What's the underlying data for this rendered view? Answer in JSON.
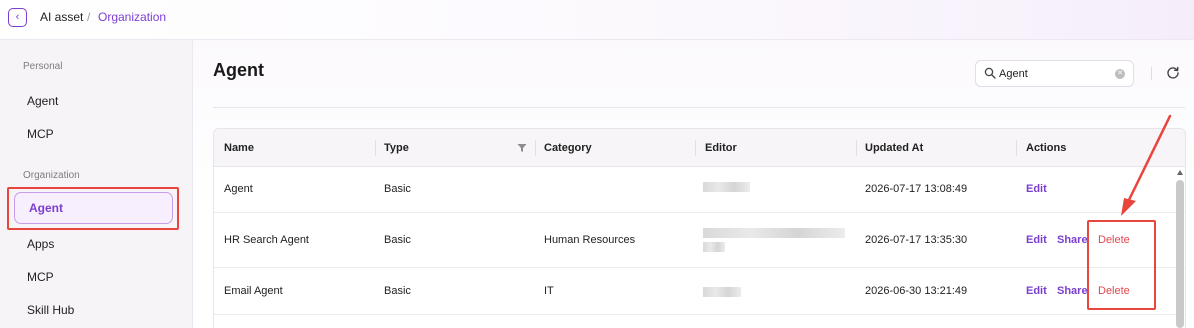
{
  "breadcrumb": {
    "root": "AI asset",
    "separator": "/",
    "current": "Organization"
  },
  "sidebar": {
    "personal_label": "Personal",
    "personal_items": [
      "Agent",
      "MCP"
    ],
    "org_label": "Organization",
    "org_items": [
      "Agent",
      "Apps",
      "MCP",
      "Skill Hub"
    ],
    "active_item": "Agent"
  },
  "main": {
    "title": "Agent",
    "search": {
      "value": "Agent",
      "placeholder": ""
    }
  },
  "table": {
    "columns": [
      "Name",
      "Type",
      "Category",
      "Editor",
      "Updated At",
      "Actions"
    ],
    "rows": [
      {
        "name": "Agent",
        "type": "Basic",
        "category": "",
        "editor": "",
        "updated_at": "2026-07-17 13:08:49",
        "actions": [
          "Edit"
        ]
      },
      {
        "name": "HR Search Agent",
        "type": "Basic",
        "category": "Human Resources",
        "editor": "",
        "updated_at": "2026-07-17 13:35:30",
        "actions": [
          "Edit",
          "Share",
          "Delete"
        ]
      },
      {
        "name": "Email Agent",
        "type": "Basic",
        "category": "IT",
        "editor": "",
        "updated_at": "2026-06-30 13:21:49",
        "actions": [
          "Edit",
          "Share",
          "Delete"
        ]
      }
    ]
  },
  "icons": {
    "back": "chevron-left-icon",
    "search": "search-icon",
    "clear": "clear-icon",
    "refresh": "refresh-icon",
    "filter": "filter-icon"
  },
  "colors": {
    "accent": "#7b3fd0",
    "danger": "#e2474f",
    "highlight": "#e8453c"
  }
}
